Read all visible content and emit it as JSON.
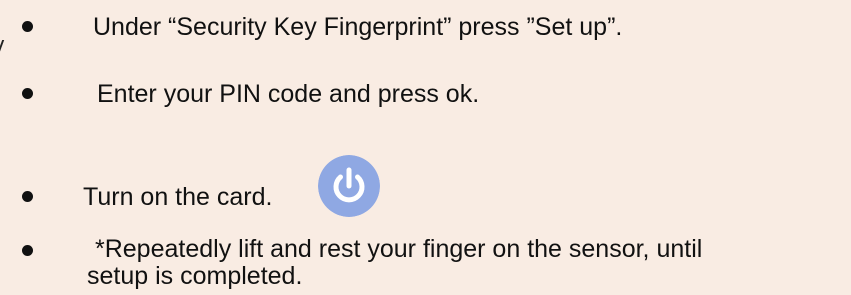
{
  "steps": [
    {
      "text": "Under “Security Key Fingerprint” press ”Set up”."
    },
    {
      "text": "Enter your PIN code and press ok."
    },
    {
      "text": "Turn on the card."
    },
    {
      "text": "*Repeatedly lift and rest your finger on the sensor, until",
      "continuation": "setup is completed."
    }
  ],
  "icon": {
    "name": "power-icon",
    "color": "#8fa8e3",
    "glyph_color": "#ffffff"
  },
  "colors": {
    "background": "#f9ece3",
    "text": "#111111"
  }
}
